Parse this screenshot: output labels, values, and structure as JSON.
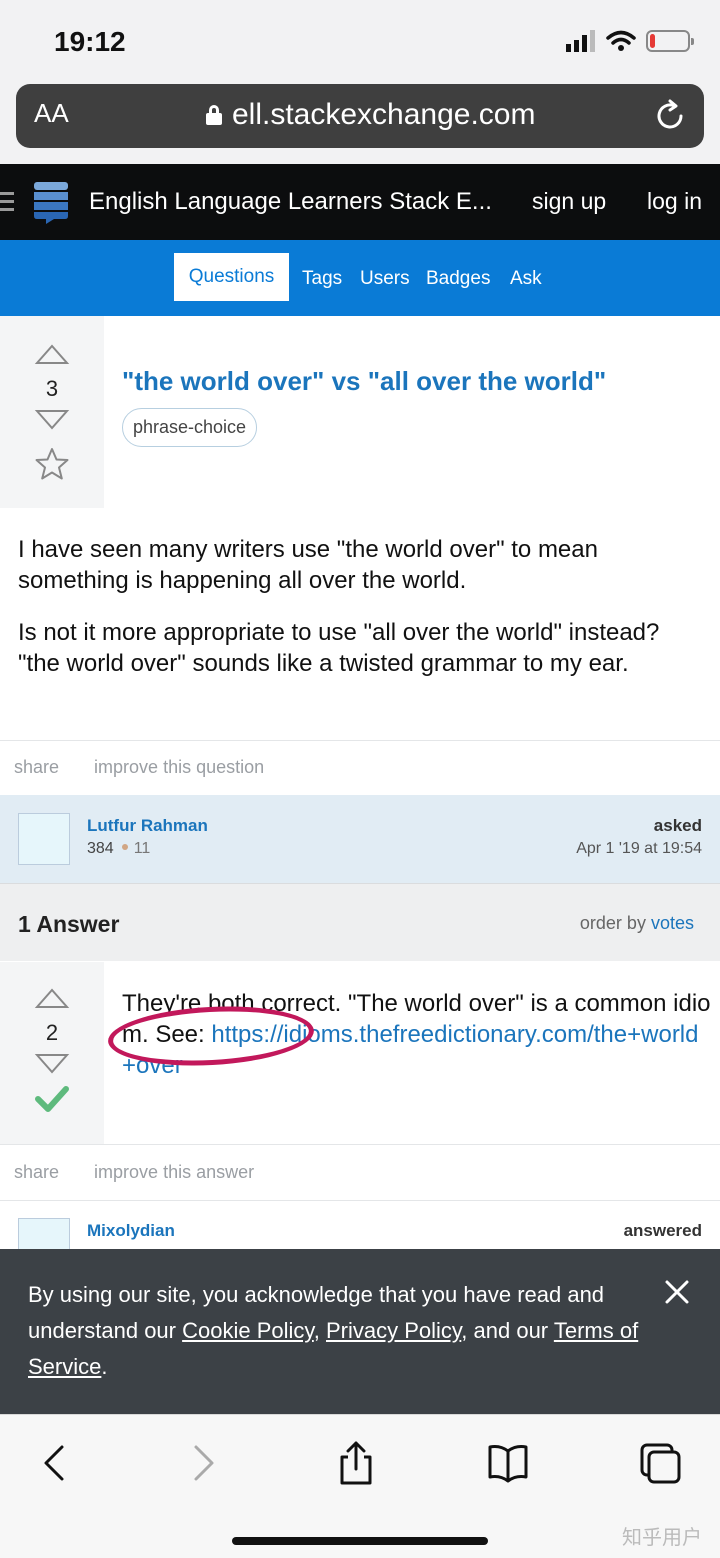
{
  "status": {
    "time": "19:12",
    "battery_level": 0.15
  },
  "browser": {
    "text_size_label": "AA",
    "url": "ell.stackexchange.com"
  },
  "site": {
    "title": "English Language Learners Stack E...",
    "signup": "sign up",
    "login": "log in"
  },
  "nav": {
    "items": [
      "Questions",
      "Tags",
      "Users",
      "Badges",
      "Ask"
    ],
    "active": "Questions"
  },
  "question": {
    "votes": "3",
    "title": "\"the world over\" vs \"all over the world\"",
    "tag": "phrase-choice",
    "body": [
      "I have seen many writers use \"the world over\" to mean something is happening all over the world.",
      "Is not it more appropriate to use \"all over the world\" instead? \"the world over\" sounds like a twisted grammar to my ear."
    ],
    "actions": [
      "share",
      "improve this question"
    ],
    "asker": {
      "name": "Lutfur Rahman",
      "rep": "384",
      "bronze": "11",
      "label": "asked",
      "date": "Apr 1 '19 at 19:54"
    }
  },
  "answers": {
    "count_label": "1 Answer",
    "order_prefix": "order by",
    "order_value": "votes",
    "items": [
      {
        "votes": "2",
        "accepted": true,
        "text": "They're both correct. \"The world over\" is a common idiom. See:",
        "link": "https://idioms.thefreedictionary.com/the+world+over",
        "actions": [
          "share",
          "improve this answer"
        ],
        "author": {
          "name": "Mixolydian",
          "label": "answered"
        }
      }
    ]
  },
  "cookie_banner": {
    "text_before": "By using our site, you acknowledge that you have read and understand our ",
    "cookie_policy": "Cookie Policy",
    "sep1": ", ",
    "privacy_policy": "Privacy Policy",
    "sep2": ", and our ",
    "terms": "Terms of Service",
    "end": "."
  },
  "toolbar": {
    "watermark": "知乎用户"
  },
  "colors": {
    "brand_blue": "#0a7bd6",
    "link": "#1b75bc",
    "accepted": "#5eba7d",
    "annotation": "#c2185b"
  }
}
